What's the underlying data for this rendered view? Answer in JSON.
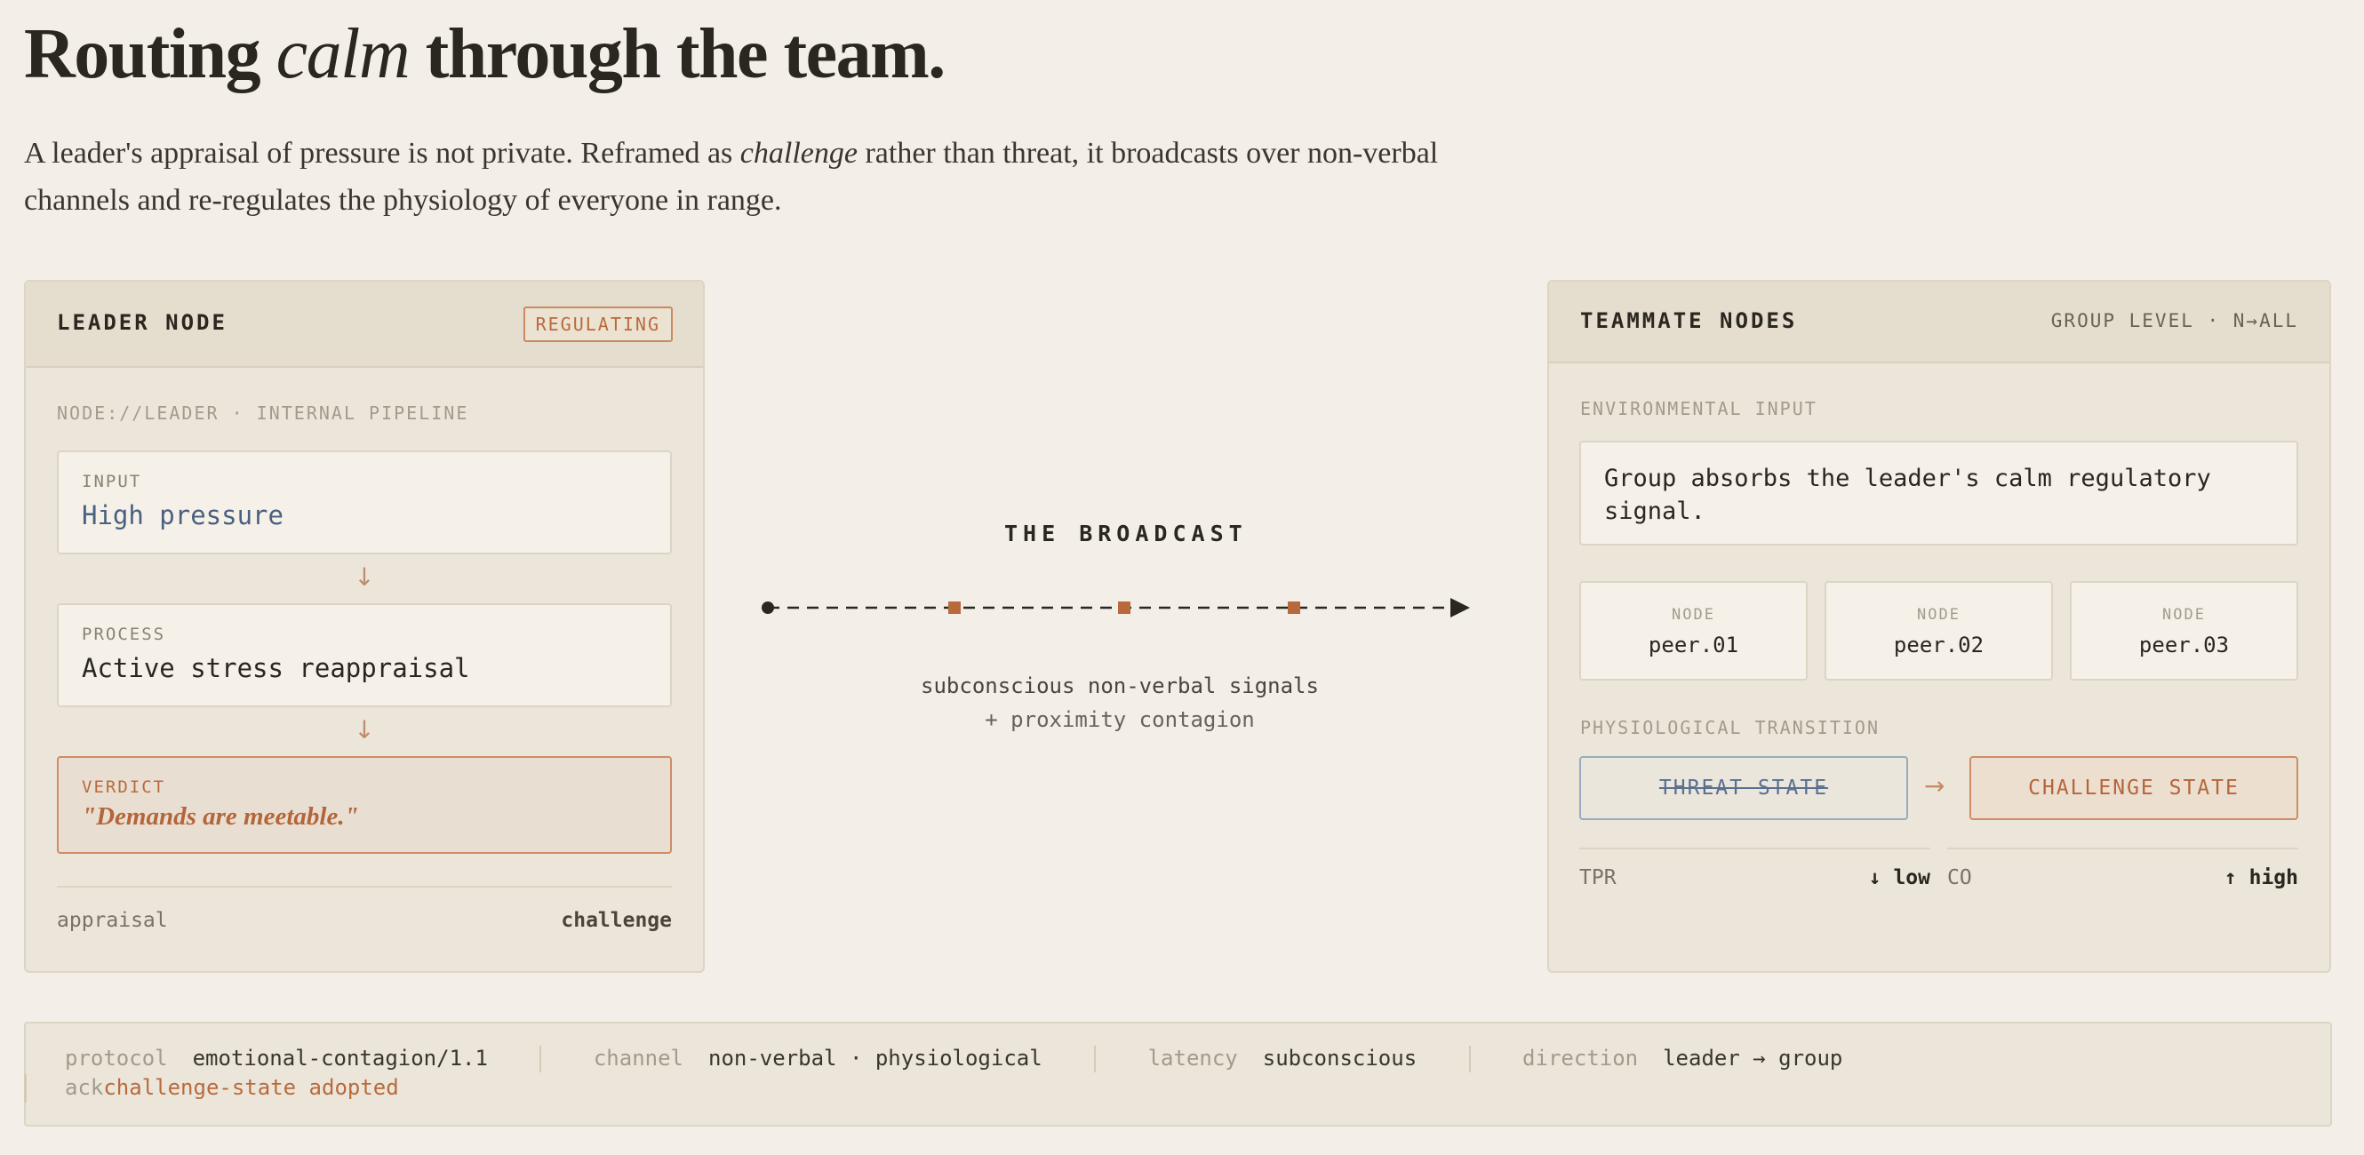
{
  "header": {
    "title_pre": "Routing ",
    "title_em": "calm",
    "title_post": " through the team.",
    "lede_pre": "A leader's appraisal of pressure is not private. Reframed as ",
    "lede_em": "challenge",
    "lede_post": " rather than threat, it broadcasts over non-verbal channels and re-regulates the physiology of everyone in range."
  },
  "leader": {
    "title": "LEADER NODE",
    "badge": "REGULATING",
    "path_label": "NODE://LEADER · INTERNAL PIPELINE",
    "input": {
      "label": "INPUT",
      "value": "High pressure"
    },
    "process": {
      "label": "PROCESS",
      "value": "Active stress reappraisal"
    },
    "verdict": {
      "label": "VERDICT",
      "value": "\"Demands are meetable.\""
    },
    "arrow_glyph": "↓",
    "footer": {
      "left": "appraisal",
      "right": "challenge"
    }
  },
  "broadcast": {
    "label": "THE BROADCAST",
    "line1": "subconscious non-verbal signals",
    "line2": "+ proximity contagion"
  },
  "team": {
    "title": "TEAMMATE NODES",
    "meta": "GROUP LEVEL · N→ALL",
    "env_label": "ENVIRONMENTAL INPUT",
    "env_text": "Group absorbs the leader's calm regulatory signal.",
    "peers": [
      {
        "label": "NODE",
        "value": "peer.01"
      },
      {
        "label": "NODE",
        "value": "peer.02"
      },
      {
        "label": "NODE",
        "value": "peer.03"
      }
    ],
    "transition_label": "PHYSIOLOGICAL TRANSITION",
    "threat": "THREAT STATE",
    "arrow_glyph": "→",
    "challenge": "CHALLENGE STATE",
    "metrics": [
      {
        "label": "TPR",
        "value": "↓ low"
      },
      {
        "label": "CO",
        "value": "↑ high"
      }
    ]
  },
  "footer": {
    "protocol_key": "protocol",
    "protocol_val": "emotional-contagion/1.1",
    "channel_key": "channel",
    "channel_val": "non-verbal · physiological",
    "latency_key": "latency",
    "latency_val": "subconscious",
    "direction_key": "direction",
    "direction_val": "leader → group",
    "ack_key": "ack",
    "ack_val": "challenge-state adopted"
  },
  "colors": {
    "background": "#f3efe8",
    "panel": "#ece6da",
    "accent": "#b96a3c",
    "threat_blue": "#5a7090",
    "ink": "#2a2620"
  }
}
